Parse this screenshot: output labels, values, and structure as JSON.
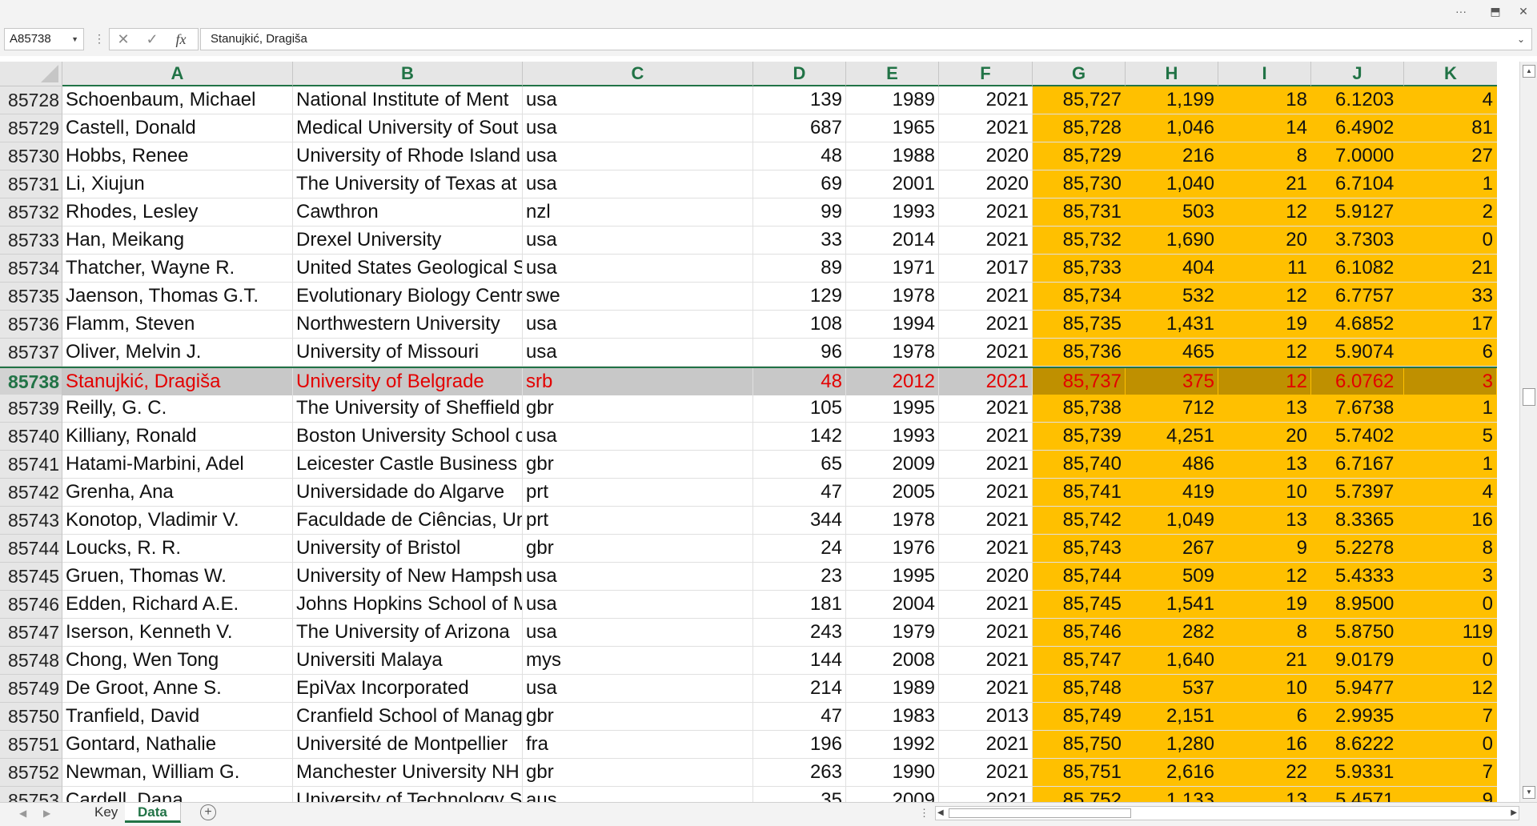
{
  "topbar": {
    "more_icon": "more-icon",
    "restore_icon": "ribbon-display-icon",
    "close_icon": "close-icon"
  },
  "formula_bar": {
    "name_box": "A85738",
    "formula": "Stanujkić, Dragiša",
    "cancel_icon": "cancel-icon",
    "enter_icon": "check-icon",
    "fx_label": "fx"
  },
  "columns": [
    "A",
    "B",
    "C",
    "D",
    "E",
    "F",
    "G",
    "H",
    "I",
    "J",
    "K"
  ],
  "rows": [
    {
      "n": "85728",
      "a": "Schoenbaum, Michael",
      "b": "National Institute of Ment",
      "c": "usa",
      "d": "139",
      "e": "1989",
      "f": "2021",
      "g": "85,727",
      "h": "1,199",
      "i": "18",
      "j": "6.1203",
      "k": "4"
    },
    {
      "n": "85729",
      "a": "Castell, Donald",
      "b": "Medical University of Sout",
      "c": "usa",
      "d": "687",
      "e": "1965",
      "f": "2021",
      "g": "85,728",
      "h": "1,046",
      "i": "14",
      "j": "6.4902",
      "k": "81"
    },
    {
      "n": "85730",
      "a": "Hobbs, Renee",
      "b": "University of Rhode Island",
      "c": "usa",
      "d": "48",
      "e": "1988",
      "f": "2020",
      "g": "85,729",
      "h": "216",
      "i": "8",
      "j": "7.0000",
      "k": "27"
    },
    {
      "n": "85731",
      "a": "Li, Xiujun",
      "b": "The University of Texas at",
      "c": "usa",
      "d": "69",
      "e": "2001",
      "f": "2020",
      "g": "85,730",
      "h": "1,040",
      "i": "21",
      "j": "6.7104",
      "k": "1"
    },
    {
      "n": "85732",
      "a": "Rhodes, Lesley",
      "b": "Cawthron",
      "c": "nzl",
      "d": "99",
      "e": "1993",
      "f": "2021",
      "g": "85,731",
      "h": "503",
      "i": "12",
      "j": "5.9127",
      "k": "2"
    },
    {
      "n": "85733",
      "a": "Han, Meikang",
      "b": "Drexel University",
      "c": "usa",
      "d": "33",
      "e": "2014",
      "f": "2021",
      "g": "85,732",
      "h": "1,690",
      "i": "20",
      "j": "3.7303",
      "k": "0"
    },
    {
      "n": "85734",
      "a": "Thatcher, Wayne R.",
      "b": "United States Geological S",
      "c": "usa",
      "d": "89",
      "e": "1971",
      "f": "2017",
      "g": "85,733",
      "h": "404",
      "i": "11",
      "j": "6.1082",
      "k": "21"
    },
    {
      "n": "85735",
      "a": "Jaenson, Thomas G.T.",
      "b": "Evolutionary Biology Centr",
      "c": "swe",
      "d": "129",
      "e": "1978",
      "f": "2021",
      "g": "85,734",
      "h": "532",
      "i": "12",
      "j": "6.7757",
      "k": "33"
    },
    {
      "n": "85736",
      "a": "Flamm, Steven",
      "b": "Northwestern University",
      "c": "usa",
      "d": "108",
      "e": "1994",
      "f": "2021",
      "g": "85,735",
      "h": "1,431",
      "i": "19",
      "j": "4.6852",
      "k": "17"
    },
    {
      "n": "85737",
      "a": "Oliver, Melvin J.",
      "b": "University of Missouri",
      "c": "usa",
      "d": "96",
      "e": "1978",
      "f": "2021",
      "g": "85,736",
      "h": "465",
      "i": "12",
      "j": "5.9074",
      "k": "6"
    },
    {
      "n": "85738",
      "a": "Stanujkić, Dragiša",
      "b": "University of Belgrade",
      "c": "srb",
      "d": "48",
      "e": "2012",
      "f": "2021",
      "g": "85,737",
      "h": "375",
      "i": "12",
      "j": "6.0762",
      "k": "3",
      "selected": true
    },
    {
      "n": "85739",
      "a": "Reilly, G. C.",
      "b": "The University of Sheffield",
      "c": "gbr",
      "d": "105",
      "e": "1995",
      "f": "2021",
      "g": "85,738",
      "h": "712",
      "i": "13",
      "j": "7.6738",
      "k": "1"
    },
    {
      "n": "85740",
      "a": "Killiany, Ronald",
      "b": "Boston University School o",
      "c": "usa",
      "d": "142",
      "e": "1993",
      "f": "2021",
      "g": "85,739",
      "h": "4,251",
      "i": "20",
      "j": "5.7402",
      "k": "5"
    },
    {
      "n": "85741",
      "a": "Hatami-Marbini, Adel",
      "b": "Leicester Castle Business S",
      "c": "gbr",
      "d": "65",
      "e": "2009",
      "f": "2021",
      "g": "85,740",
      "h": "486",
      "i": "13",
      "j": "6.7167",
      "k": "1"
    },
    {
      "n": "85742",
      "a": "Grenha, Ana",
      "b": "Universidade do Algarve",
      "c": "prt",
      "d": "47",
      "e": "2005",
      "f": "2021",
      "g": "85,741",
      "h": "419",
      "i": "10",
      "j": "5.7397",
      "k": "4"
    },
    {
      "n": "85743",
      "a": "Konotop, Vladimir V.",
      "b": "Faculdade de Ciências, Un",
      "c": "prt",
      "d": "344",
      "e": "1978",
      "f": "2021",
      "g": "85,742",
      "h": "1,049",
      "i": "13",
      "j": "8.3365",
      "k": "16"
    },
    {
      "n": "85744",
      "a": "Loucks, R. R.",
      "b": "University of Bristol",
      "c": "gbr",
      "d": "24",
      "e": "1976",
      "f": "2021",
      "g": "85,743",
      "h": "267",
      "i": "9",
      "j": "5.2278",
      "k": "8"
    },
    {
      "n": "85745",
      "a": "Gruen, Thomas W.",
      "b": "University of New Hampsh",
      "c": "usa",
      "d": "23",
      "e": "1995",
      "f": "2020",
      "g": "85,744",
      "h": "509",
      "i": "12",
      "j": "5.4333",
      "k": "3"
    },
    {
      "n": "85746",
      "a": "Edden, Richard A.E.",
      "b": "Johns Hopkins School of M",
      "c": "usa",
      "d": "181",
      "e": "2004",
      "f": "2021",
      "g": "85,745",
      "h": "1,541",
      "i": "19",
      "j": "8.9500",
      "k": "0"
    },
    {
      "n": "85747",
      "a": "Iserson, Kenneth V.",
      "b": "The University of Arizona",
      "c": "usa",
      "d": "243",
      "e": "1979",
      "f": "2021",
      "g": "85,746",
      "h": "282",
      "i": "8",
      "j": "5.8750",
      "k": "119"
    },
    {
      "n": "85748",
      "a": "Chong, Wen Tong",
      "b": "Universiti Malaya",
      "c": "mys",
      "d": "144",
      "e": "2008",
      "f": "2021",
      "g": "85,747",
      "h": "1,640",
      "i": "21",
      "j": "9.0179",
      "k": "0"
    },
    {
      "n": "85749",
      "a": "De Groot, Anne S.",
      "b": "EpiVax Incorporated",
      "c": "usa",
      "d": "214",
      "e": "1989",
      "f": "2021",
      "g": "85,748",
      "h": "537",
      "i": "10",
      "j": "5.9477",
      "k": "12"
    },
    {
      "n": "85750",
      "a": "Tranfield, David",
      "b": "Cranfield School of Manag",
      "c": "gbr",
      "d": "47",
      "e": "1983",
      "f": "2013",
      "g": "85,749",
      "h": "2,151",
      "i": "6",
      "j": "2.9935",
      "k": "7"
    },
    {
      "n": "85751",
      "a": "Gontard, Nathalie",
      "b": "Université de Montpellier",
      "c": "fra",
      "d": "196",
      "e": "1992",
      "f": "2021",
      "g": "85,750",
      "h": "1,280",
      "i": "16",
      "j": "8.6222",
      "k": "0"
    },
    {
      "n": "85752",
      "a": "Newman, William G.",
      "b": "Manchester University NH",
      "c": "gbr",
      "d": "263",
      "e": "1990",
      "f": "2021",
      "g": "85,751",
      "h": "2,616",
      "i": "22",
      "j": "5.9331",
      "k": "7"
    },
    {
      "n": "85753",
      "a": "Cardell, Dana",
      "b": "University of Technology S",
      "c": "aus",
      "d": "35",
      "e": "2009",
      "f": "2021",
      "g": "85,752",
      "h": "1,133",
      "i": "13",
      "j": "5.4571",
      "k": "9"
    }
  ],
  "sheets": {
    "tab1": "Key",
    "tab2": "Data",
    "active": "Data"
  },
  "colors": {
    "accent": "#217346",
    "highlight": "#ffc000",
    "selected_text": "#e30000"
  }
}
